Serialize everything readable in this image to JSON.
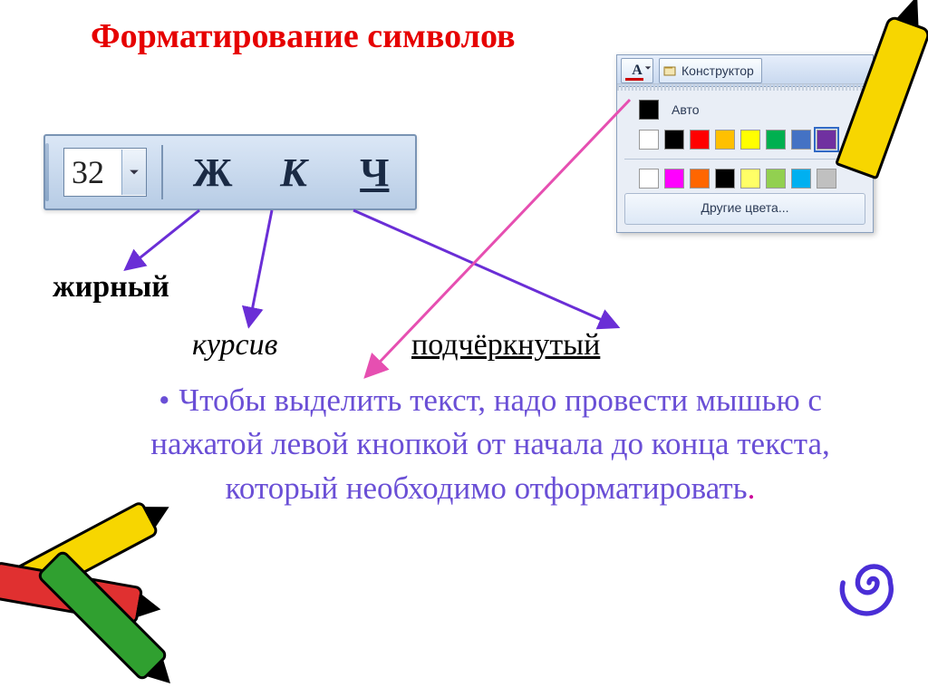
{
  "title": "Форматирование символов",
  "toolbar": {
    "font_size": "32",
    "bold_glyph": "Ж",
    "italic_glyph": "К",
    "underline_glyph": "Ч"
  },
  "labels": {
    "bold": "жирный",
    "italic": "курсив",
    "underline": "подчёркнутый"
  },
  "color_panel": {
    "font_color_glyph": "А",
    "constructor": "Конструктор",
    "auto_label": "Авто",
    "row1": [
      "#ffffff",
      "#000000",
      "#ff0000",
      "#ffc000",
      "#ffff00",
      "#00b050",
      "#4472c4",
      "#7030a0"
    ],
    "row2": [
      "#ffffff",
      "#ff00ff",
      "#ff6600",
      "#000000",
      "#ffff66",
      "#92d050",
      "#00b0f0",
      "#c0c0c0"
    ],
    "selected_index": 7,
    "more_colors": "Другие цвета..."
  },
  "bullet_text": "Чтобы выделить текст, надо провести мышью с нажатой левой кнопкой от начала до конца текста, который необходимо отформатировать",
  "period": "."
}
